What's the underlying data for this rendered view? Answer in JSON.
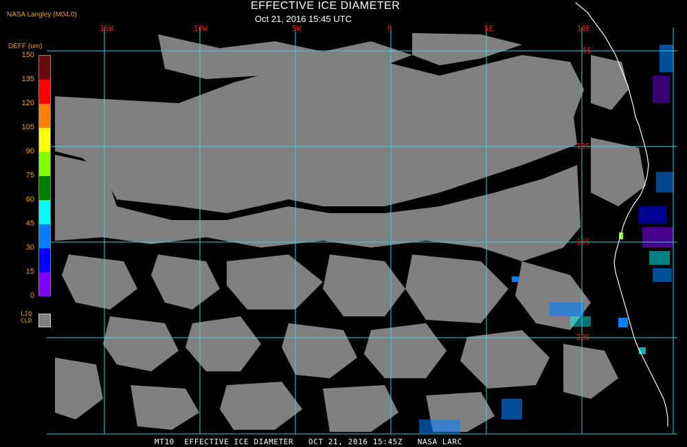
{
  "header": {
    "credit": "NASA Langley (M04.0)",
    "title": "EFFECTIVE ICE DIAMETER",
    "subtitle": "Oct 21, 2016 15:45 UTC"
  },
  "legend": {
    "title": "DEFF (um)",
    "ticks": [
      "150",
      "135",
      "120",
      "105",
      "90",
      "75",
      "60",
      "45",
      "30",
      "15",
      "0"
    ],
    "colors": [
      "#6b0a0a",
      "#ff0000",
      "#ff8000",
      "#ffff00",
      "#80ff00",
      "#008000",
      "#00ffff",
      "#0080ff",
      "#0000ff",
      "#8000ff"
    ],
    "liquid_label_line1": "LIQ",
    "liquid_label_line2": "CLD",
    "liquid_color": "#808080"
  },
  "map": {
    "lon_labels": [
      "15W",
      "10W",
      "5W",
      "0",
      "5E",
      "10E"
    ],
    "lat_labels": [
      "5S",
      "10S",
      "15S",
      "20S"
    ],
    "grid_color": "#40d0e0",
    "coast_color": "#ffffff",
    "cloud_color": "#808080",
    "background_color": "#000000"
  },
  "footer": {
    "text": "MT10  EFFECTIVE ICE DIAMETER   OCT 21, 2016 15:45Z   NASA LARC"
  }
}
